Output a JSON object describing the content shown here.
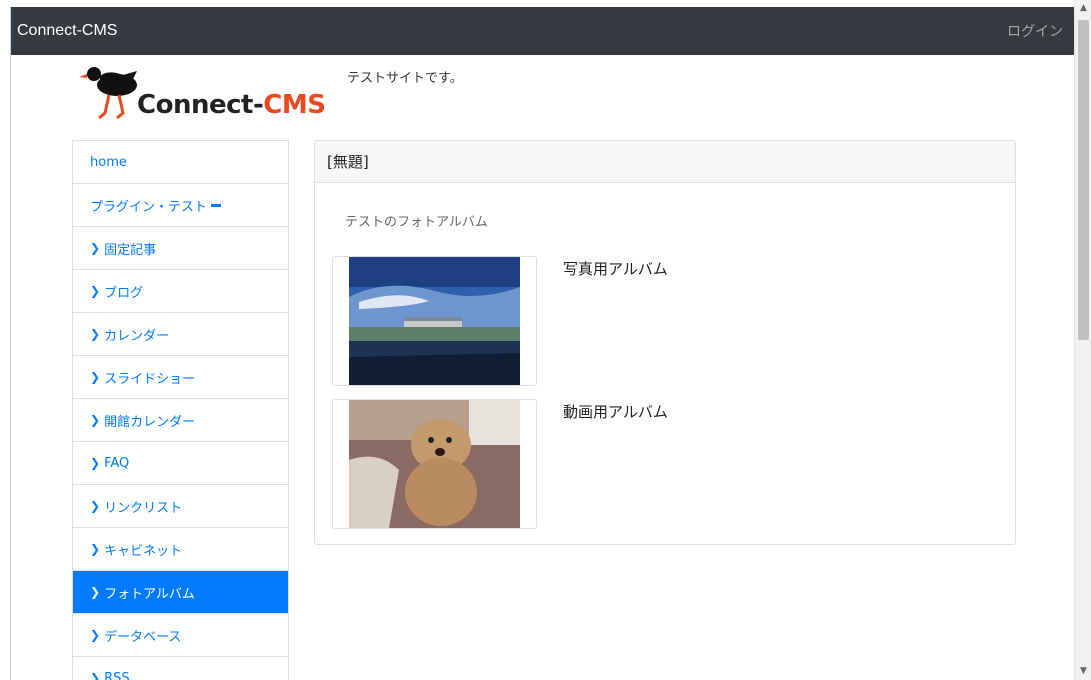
{
  "navbar": {
    "brand": "Connect-CMS",
    "login": "ログイン"
  },
  "logo": {
    "text_main": "Connect-",
    "text_accent": "CMS"
  },
  "site_description": "テストサイトです。",
  "sidebar": {
    "items": [
      {
        "label": "home",
        "active": false,
        "chevron": false
      },
      {
        "label": "プラグイン・テスト",
        "active": false,
        "chevron": false,
        "expanded": true
      },
      {
        "label": "固定記事",
        "active": false,
        "chevron": true
      },
      {
        "label": "ブログ",
        "active": false,
        "chevron": true
      },
      {
        "label": "カレンダー",
        "active": false,
        "chevron": true
      },
      {
        "label": "スライドショー",
        "active": false,
        "chevron": true
      },
      {
        "label": "開館カレンダー",
        "active": false,
        "chevron": true
      },
      {
        "label": "FAQ",
        "active": false,
        "chevron": true
      },
      {
        "label": "リンクリスト",
        "active": false,
        "chevron": true
      },
      {
        "label": "キャビネット",
        "active": false,
        "chevron": true
      },
      {
        "label": "フォトアルバム",
        "active": true,
        "chevron": true
      },
      {
        "label": "データベース",
        "active": false,
        "chevron": true
      },
      {
        "label": "RSS",
        "active": false,
        "chevron": true
      }
    ]
  },
  "main": {
    "card_title": "[無題]",
    "album_description": "テストのフォトアルバム",
    "albums": [
      {
        "name": "写真用アルバム",
        "thumbnail_icon": "building-waterfront-photo"
      },
      {
        "name": "動画用アルバム",
        "thumbnail_icon": "poodle-dog-photo"
      }
    ]
  },
  "colors": {
    "navbar": "#343a40",
    "link": "#007bff",
    "active": "#007bff",
    "accent": "#e8491d"
  }
}
